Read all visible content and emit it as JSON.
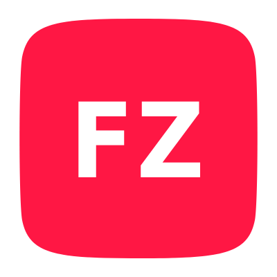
{
  "app_icon": {
    "label": "FZ",
    "background_color": "#FF1744",
    "text_color": "#FFFFFF",
    "shape": "squircle"
  }
}
